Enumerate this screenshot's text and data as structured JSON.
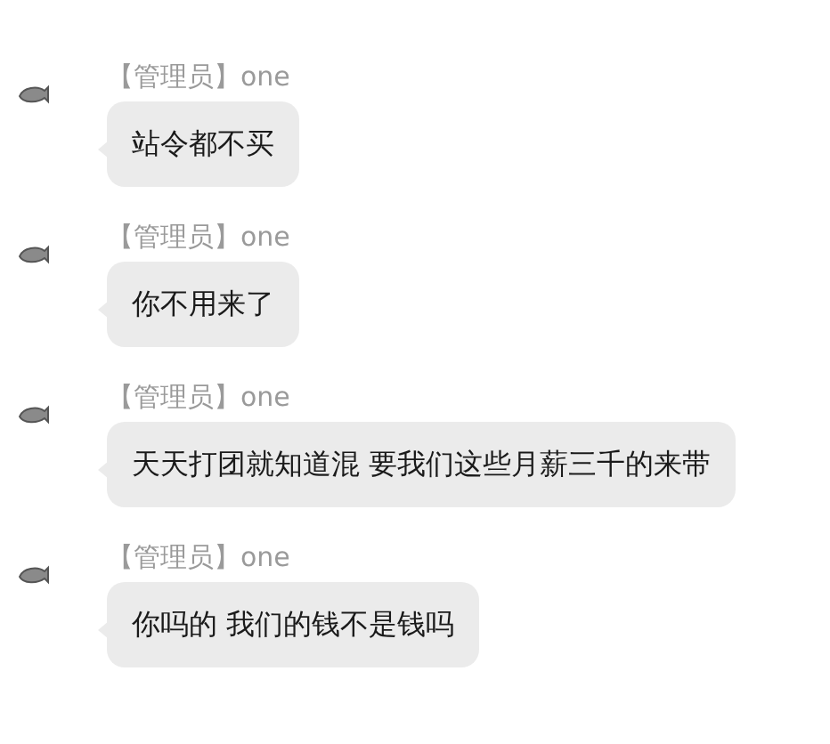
{
  "messages": [
    {
      "sender": "【管理员】one",
      "text": "站令都不买"
    },
    {
      "sender": "【管理员】one",
      "text": "你不用来了"
    },
    {
      "sender": "【管理员】one",
      "text": "天天打团就知道混 要我们这些月薪三千的来带"
    },
    {
      "sender": "【管理员】one",
      "text": "你吗的 我们的钱不是钱吗"
    }
  ]
}
